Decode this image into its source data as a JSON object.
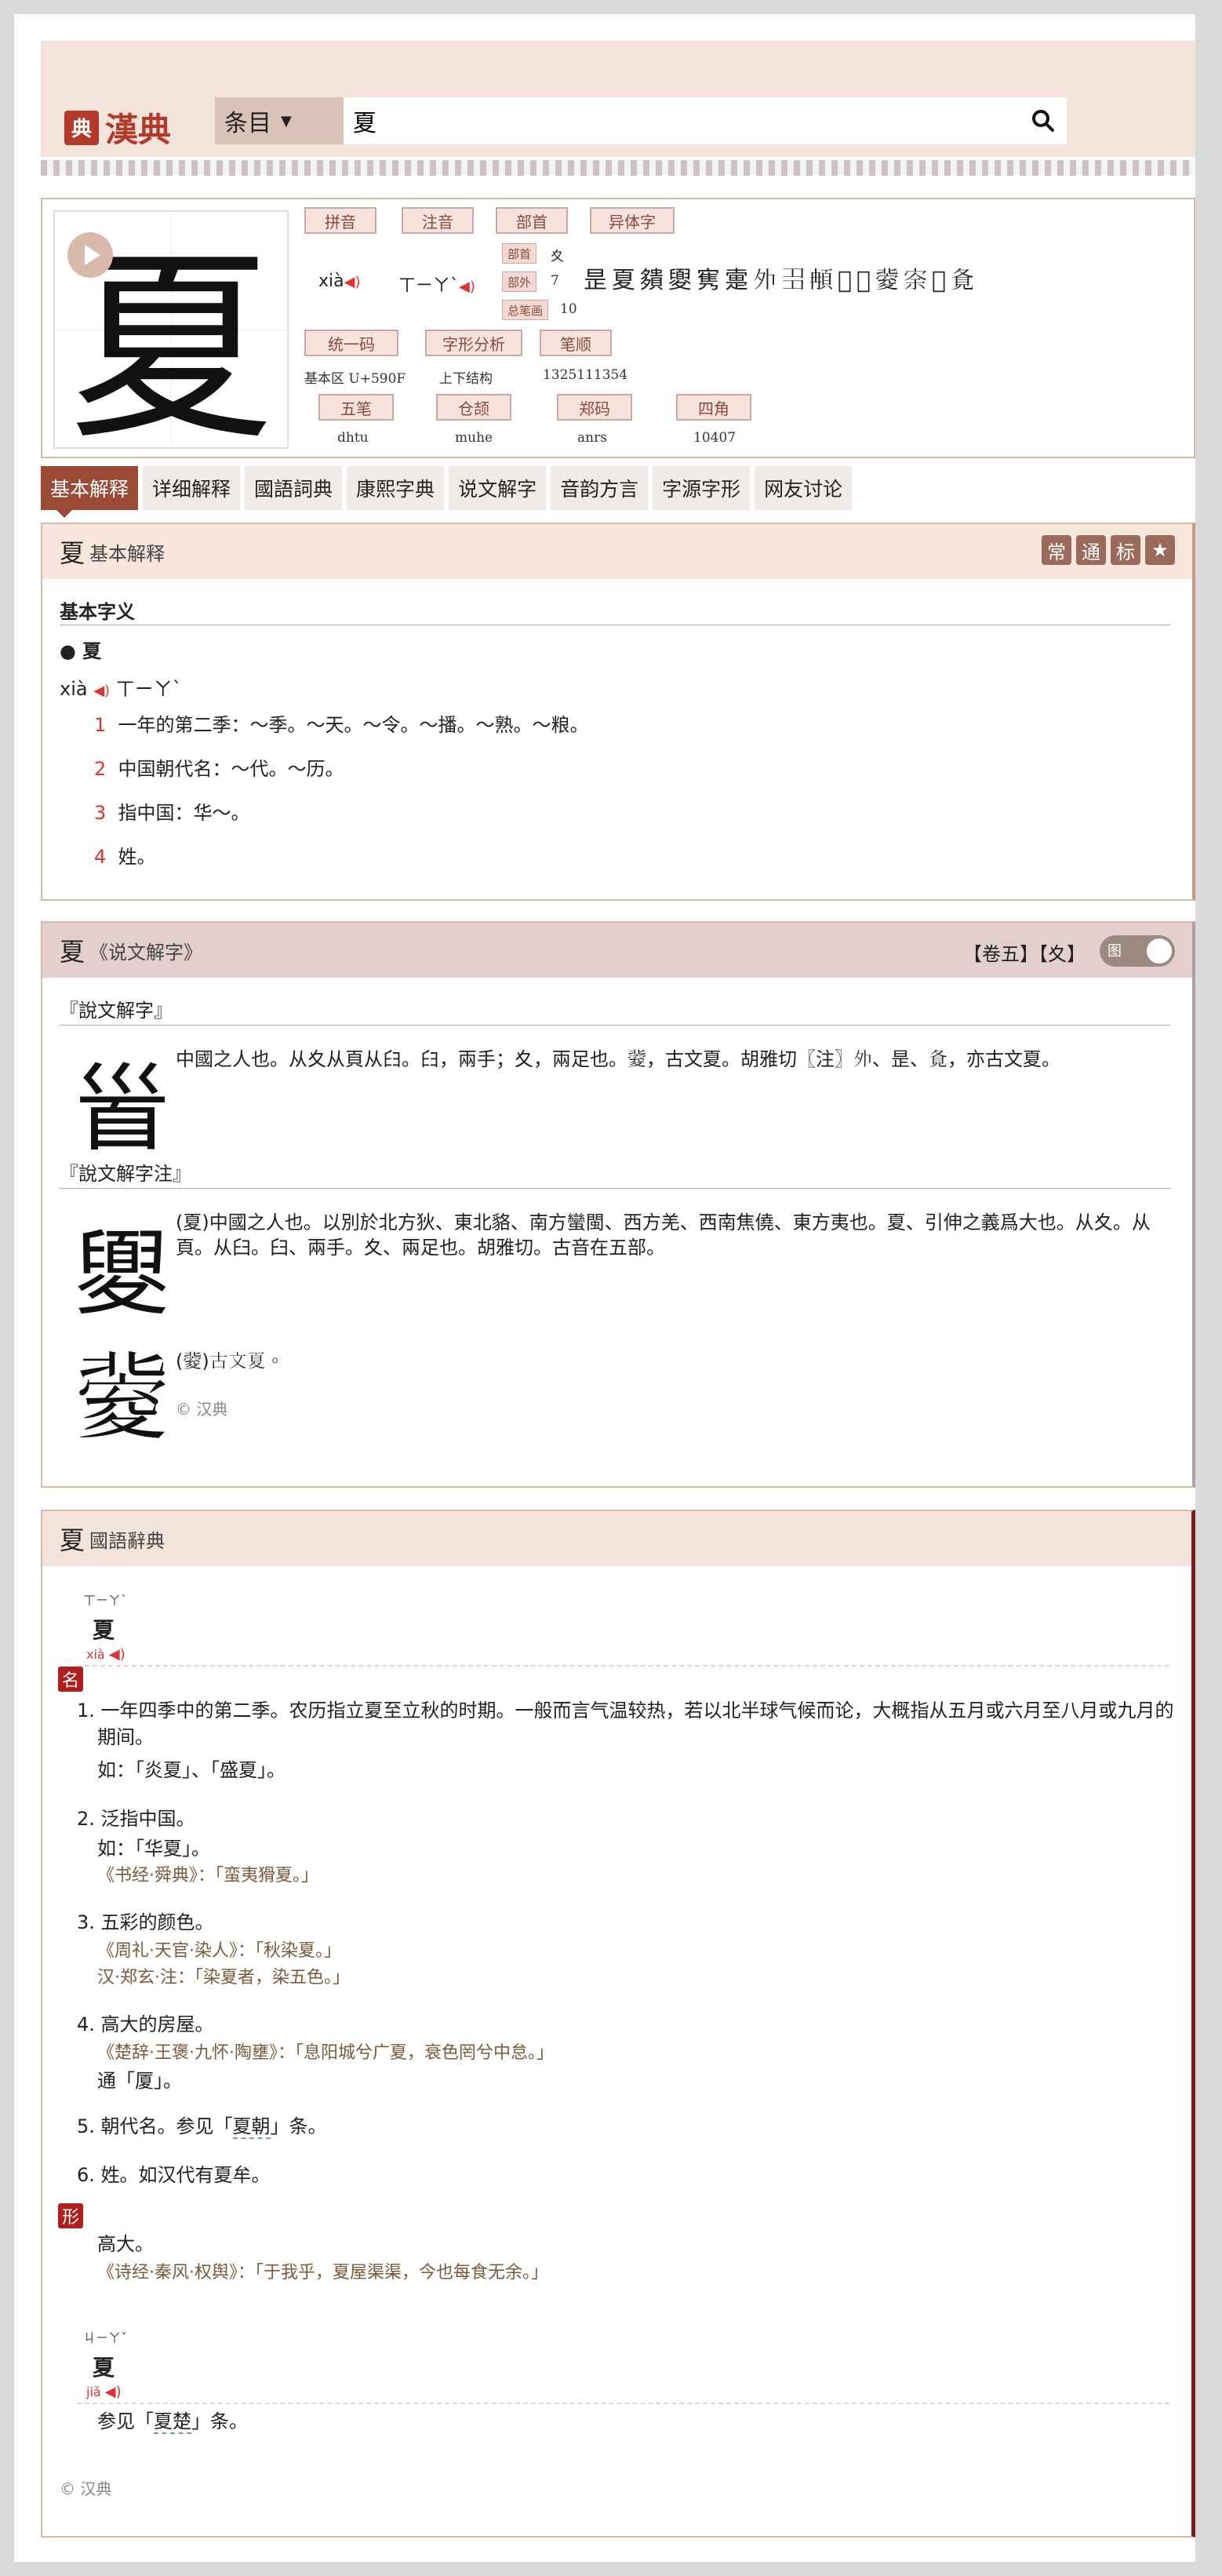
{
  "header": {
    "logo_badge": "典",
    "logo_text": "漢典",
    "search_type": "条目",
    "search_value": "夏",
    "search_icon": "search-icon"
  },
  "char_info": {
    "character": "夏",
    "labels": {
      "pinyin": "拼音",
      "zhuyin": "注音",
      "bushou": "部首",
      "yiti": "异体字",
      "unicode": "统一码",
      "zixing": "字形分析",
      "bishun": "笔顺",
      "wubi": "五笔",
      "cangjie": "仓颉",
      "zhengma": "郑码",
      "sijiao": "四角",
      "bushou_small": "部首",
      "buwai_small": "部外",
      "zongbihua_small": "总笔画"
    },
    "pinyin": "xià",
    "zhuyin": "ㄒㄧㄚˋ",
    "bushou": "夊",
    "buwai": "7",
    "zongbihua": "10",
    "variants": "昰夏㚍夓㝦疐𡖄𡖈𩑺𡓆𡚀𡕶𡨀𥂚𡕚",
    "unicode": "基本区 U+590F",
    "zixing": "上下结构",
    "bishun": "1325111354",
    "wubi": "dhtu",
    "cangjie": "muhe",
    "zhengma": "anrs",
    "sijiao": "10407"
  },
  "tabs": [
    "基本解释",
    "详细解释",
    "國語詞典",
    "康熙字典",
    "说文解字",
    "音韵方言",
    "字源字形",
    "网友讨论"
  ],
  "basic": {
    "title": "夏",
    "subtitle": "基本解释",
    "badges": [
      "常",
      "通",
      "标",
      "★"
    ],
    "section_label": "基本字义",
    "head_char": "● 夏",
    "pinyin": "xià",
    "zhuyin": "ㄒㄧㄚˋ",
    "defs": [
      {
        "n": "1",
        "t": "一年的第二季：～季。～天。～令。～播。～熟。～粮。"
      },
      {
        "n": "2",
        "t": "中国朝代名：～代。～历。"
      },
      {
        "n": "3",
        "t": "指中国：华～。"
      },
      {
        "n": "4",
        "t": "姓。"
      }
    ]
  },
  "shuowen": {
    "title": "夏",
    "subtitle": "《说文解字》",
    "tags": "【卷五】【夊】",
    "toggle_label": "图",
    "label1": "『說文解字』",
    "text1": "中國之人也。从夊从頁从𦥑。𦥑，兩手；夊，兩足也。𡕶，古文夏。胡雅切〖注〗𡖄、昰、𡕚，亦古文夏。",
    "label2": "『說文解字注』",
    "text2a": "(夏)中國之人也。以別於北方狄、東北貉、南方蠻閩、西方羌、西南焦僥、東方夷也。夏、引伸之義爲大也。从夊。从",
    "text2b": "頁。从臼。臼、兩手。夊、兩足也。胡雅切。古音在五部。",
    "text3": "(𡕶)古文夏。",
    "copyright": "© 汉典",
    "seal1": "𩠐",
    "seal2": "夓",
    "seal3": "𡕶"
  },
  "guoyu": {
    "title": "夏",
    "subtitle": "國語辭典",
    "entry1": {
      "zhuyin": "ㄒㄧㄚˋ",
      "char": "夏",
      "pinyin": "xià"
    },
    "pos1": "名",
    "d1a": "1. 一年四季中的第二季。农历指立夏至立秋的时期。一般而言气温较热，若以北半球气候而论，大概指从五月或六月至八月或九月的",
    "d1b": "期间。",
    "d1ex": "如：「炎夏」、「盛夏」。",
    "d2": "2. 泛指中国。",
    "d2ex": "如：「华夏」。",
    "d2cite": "《书经·舜典》：「蛮夷猾夏。」",
    "d3": "3. 五彩的颜色。",
    "d3cite1": "《周礼·天官·染人》：「秋染夏。」",
    "d3cite2": "汉·郑玄·注：「染夏者，染五色。」",
    "d4": "4. 高大的房屋。",
    "d4cite": "《楚辞·王褒·九怀·陶壅》：「息阳城兮广夏，衰色罔兮中怠。」",
    "d4ex": "通「厦」。",
    "d5a": "5. 朝代名。参见「",
    "d5link": "夏朝",
    "d5b": "」条。",
    "d6": "6. 姓。如汉代有夏牟。",
    "pos2": "形",
    "x1": "高大。",
    "x1cite": "《诗经·秦风·权舆》：「于我乎，夏屋渠渠，今也每食无余。」",
    "entry2": {
      "zhuyin": "ㄐㄧㄚˇ",
      "char": "夏",
      "pinyin": "jiǎ"
    },
    "j1a": "参见「",
    "j1link": "夏楚",
    "j1b": "」条。",
    "copyright": "© 汉典"
  }
}
